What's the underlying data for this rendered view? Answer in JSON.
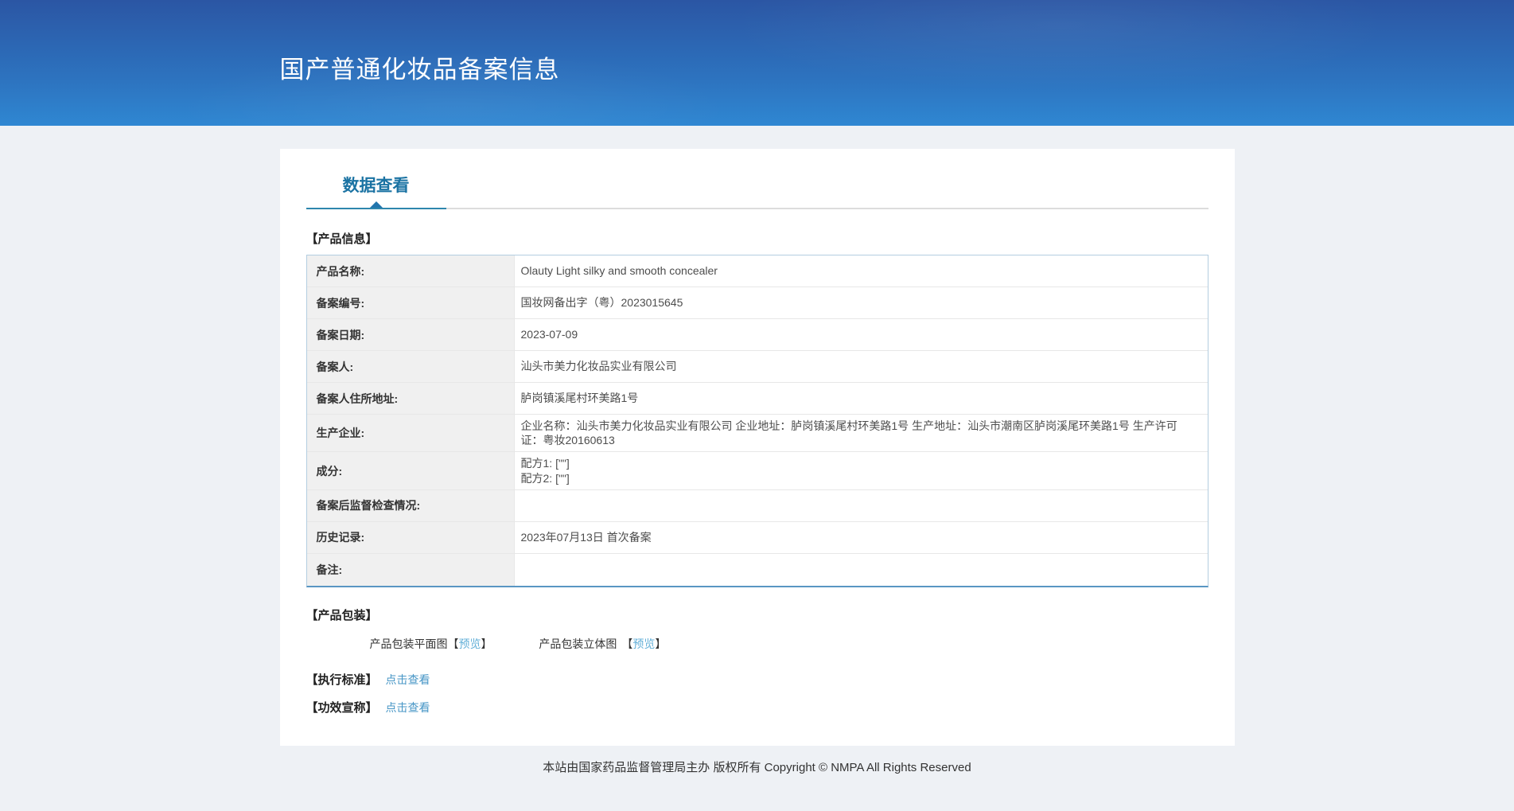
{
  "header": {
    "title": "国产普通化妆品备案信息"
  },
  "tabs": {
    "data_view": "数据查看"
  },
  "product_info": {
    "section_title": "【产品信息】",
    "rows": [
      {
        "label": "产品名称:",
        "value": "Olauty Light silky and smooth concealer"
      },
      {
        "label": "备案编号:",
        "value": "国妆网备出字（粤）2023015645"
      },
      {
        "label": "备案日期:",
        "value": "2023-07-09"
      },
      {
        "label": "备案人:",
        "value": "汕头市美力化妆品实业有限公司"
      },
      {
        "label": "备案人住所地址:",
        "value": "胪岗镇溪尾村环美路1号"
      },
      {
        "label": "生产企业:",
        "value": "企业名称：汕头市美力化妆品实业有限公司 企业地址：胪岗镇溪尾村环美路1号 生产地址：汕头市潮南区胪岗溪尾环美路1号 生产许可证：粤妆20160613"
      },
      {
        "label": "成分:",
        "value": "配方1: [\"\"]\n配方2: [\"\"]"
      },
      {
        "label": "备案后监督检查情况:",
        "value": ""
      },
      {
        "label": "历史记录:",
        "value": "2023年07月13日 首次备案"
      },
      {
        "label": "备注:",
        "value": ""
      }
    ]
  },
  "packaging": {
    "section_title": "【产品包装】",
    "flat_label": "产品包装平面图",
    "stereo_label": "产品包装立体图",
    "preview_label": "预览",
    "bracket_open": "【",
    "bracket_close": "】"
  },
  "standard": {
    "title": "【执行标准】",
    "link": "点击查看"
  },
  "efficacy": {
    "title": "【功效宣称】",
    "link": "点击查看"
  },
  "footer": {
    "copyright": "本站由国家药品监督管理局主办 版权所有 Copyright © NMPA All Rights Reserved"
  },
  "colors": {
    "header_gradient_top": "#2b56a4",
    "header_gradient_bottom": "#2f87d2",
    "tab_accent": "#1b73a3",
    "tab_underline": "#2e86ad",
    "table_border": "#b3cde0",
    "table_border_bottom": "#5996c3",
    "label_cell_background": "#f0f0f0",
    "link_blue": "#4796c6",
    "preview_link_blue": "#64b0d8",
    "page_background": "#eef1f5"
  }
}
